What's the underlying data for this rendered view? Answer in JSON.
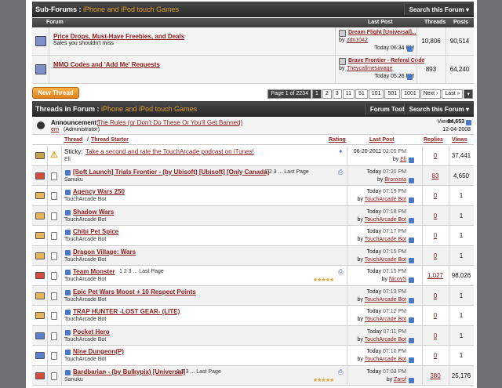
{
  "subforums": {
    "title": "Sub-Forums",
    "section": "iPhone and iPod touch Games",
    "search": "Search this Forum",
    "cols": {
      "forum": "Forum",
      "last": "Last Post",
      "threads": "Threads",
      "posts": "Posts"
    },
    "items": [
      {
        "name": "Price Drops, Must-Have Freebies, and Deals",
        "desc": "Sales you shouldn't miss",
        "last_title": "Dream Flight [Universal]...",
        "by": "by",
        "user": "zdn1042",
        "time": "Today 06:34 PM",
        "threads": "10,806",
        "posts": "90,514"
      },
      {
        "name": "MMO Codes and 'Add Me' Requests",
        "desc": "",
        "last_title": "Brave Frontier - Referal Code",
        "by": "by",
        "user": "Theycallmesavage",
        "time": "Today 05:26 PM",
        "threads": "893",
        "posts": "64,240"
      }
    ]
  },
  "new_thread": "New Thread",
  "pager": {
    "label": "Page 1 of 2234",
    "pages": [
      "1",
      "2",
      "3",
      "11",
      "51",
      "101",
      "501",
      "1001"
    ],
    "next": "Next ›",
    "last": "Last »"
  },
  "threads": {
    "title": "Threads in Forum",
    "section": "iPhone and iPod touch Games",
    "tools": "Forum Tools",
    "search": "Search this Forum",
    "announce": {
      "label": "Announcement:",
      "title": "The Rules (or Don't Do These Or You'll Get Banned)",
      "user": "ern",
      "role": "(Administrator)",
      "views_label": "Views:",
      "views": "94,653",
      "date": "12-04-2008"
    },
    "cols": {
      "thread": "Thread",
      "starter": "Thread Starter",
      "rating": "Rating",
      "last": "Last Post",
      "replies": "Replies",
      "views": "Views"
    },
    "rows": [
      {
        "prefix": "Sticky:",
        "title": "Take a second and rate the TouchArcade podcast on iTunes!",
        "starter": "Eli",
        "date": "06-20-2011",
        "time": "02:05 PM",
        "user": "Eli",
        "replies": "0",
        "views": "37,441"
      },
      {
        "prefix": "",
        "title": "[Soft Launch] Trials Frontier - (by Ubisoft) [Ubisoft] [Only Canada]",
        "pages": "1 2 3 ... Last Page",
        "starter": "Sanuku",
        "date": "Today",
        "time": "07:20 PM",
        "user": "Bronxsta",
        "replies": "83",
        "views": "4,650"
      },
      {
        "prefix": "",
        "title": "Agency Wars 250",
        "starter": "TouchArcade Bot",
        "date": "Today",
        "time": "07:19 PM",
        "user": "TouchArcade Bot",
        "replies": "0",
        "views": "1"
      },
      {
        "prefix": "",
        "title": "Shadow Wars",
        "starter": "TouchArcade Bot",
        "date": "Today",
        "time": "07:18 PM",
        "user": "TouchArcade Bot",
        "replies": "0",
        "views": "1"
      },
      {
        "prefix": "",
        "title": "Chibi Pet Spice",
        "starter": "TouchArcade Bot",
        "date": "Today",
        "time": "07:17 PM",
        "user": "TouchArcade Bot",
        "replies": "0",
        "views": "1"
      },
      {
        "prefix": "",
        "title": "Dragon Village: Wars",
        "starter": "TouchArcade Bot",
        "date": "Today",
        "time": "07:15 PM",
        "user": "TouchArcade Bot",
        "replies": "0",
        "views": "1"
      },
      {
        "prefix": "",
        "title": "Team Monster",
        "pages": "1 2 3 ... Last Page",
        "starter": "TouchArcade Bot",
        "date": "Today",
        "time": "07:15 PM",
        "user": "NicoyS",
        "replies": "1,027",
        "views": "98,026"
      },
      {
        "prefix": "",
        "title": "Epic Pet Wars Moost + 10 Respect Points",
        "starter": "TouchArcade Bot",
        "date": "Today",
        "time": "07:13 PM",
        "user": "TouchArcade Bot",
        "replies": "0",
        "views": "1"
      },
      {
        "prefix": "",
        "title": "TRAP HUNTER -LOST GEAR- (LITE)",
        "starter": "TouchArcade Bot",
        "date": "Today",
        "time": "07:12 PM",
        "user": "TouchArcade Bot",
        "replies": "0",
        "views": "1"
      },
      {
        "prefix": "",
        "title": "Pocket Hero",
        "starter": "TouchArcade Bot",
        "date": "Today",
        "time": "07:11 PM",
        "user": "TouchArcade Bot",
        "replies": "0",
        "views": "1"
      },
      {
        "prefix": "",
        "title": "Nine Dungeon(P)",
        "starter": "TouchArcade Bot",
        "date": "Today",
        "time": "07:10 PM",
        "user": "TouchArcade Bot",
        "replies": "0",
        "views": "1"
      },
      {
        "prefix": "",
        "title": "Bardbarian - (by Bulkypix) [Universal]",
        "pages": "1 2 3 ... Last Page",
        "starter": "Sanuku",
        "date": "Today",
        "time": "07:03 PM",
        "user": "Zarsf",
        "replies": "380",
        "views": "25,176"
      }
    ]
  }
}
